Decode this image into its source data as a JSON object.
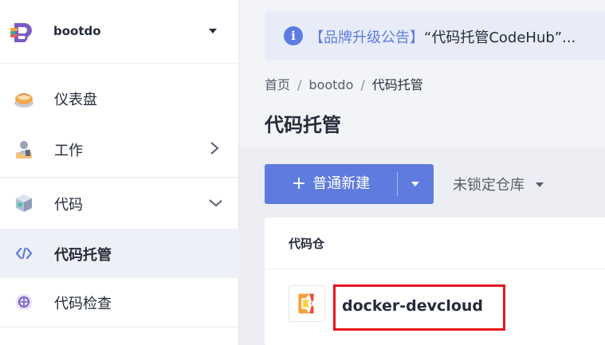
{
  "sidebar": {
    "project_name": "bootdo",
    "items": [
      {
        "label": "仪表盘",
        "icon": "dashboard-icon"
      },
      {
        "label": "工作",
        "icon": "work-icon"
      },
      {
        "label": "代码",
        "icon": "code-icon"
      },
      {
        "label": "代码托管",
        "icon": "code-hosting-icon",
        "active": true
      },
      {
        "label": "代码检查",
        "icon": "code-check-icon"
      }
    ]
  },
  "announcement": {
    "brand_text": "【品牌升级公告】",
    "text": "“代码托管CodeHub”..."
  },
  "breadcrumb": {
    "items": [
      "首页",
      "bootdo",
      "代码托管"
    ],
    "separator": "/"
  },
  "page_title": "代码托管",
  "toolbar": {
    "new_button_label": "普通新建",
    "filter_label": "未锁定仓库"
  },
  "table": {
    "column_header": "代码仓",
    "rows": [
      {
        "name": "docker-devcloud"
      }
    ]
  },
  "colors": {
    "accent": "#5e7ce0",
    "highlight_border": "#e8141e"
  }
}
